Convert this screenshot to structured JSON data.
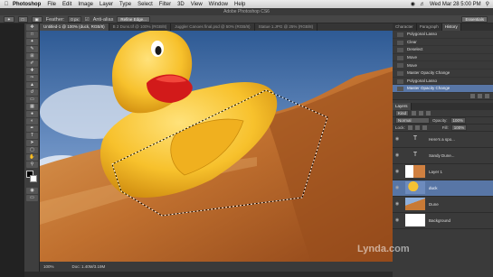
{
  "menubar": {
    "app": "Photoshop",
    "items": [
      "File",
      "Edit",
      "Image",
      "Layer",
      "Type",
      "Select",
      "Filter",
      "3D",
      "View",
      "Window",
      "Help"
    ],
    "clock": "Wed Mar 28  5:00 PM"
  },
  "window_title": "Adobe Photoshop CS6",
  "options": {
    "feather_label": "Feather:",
    "feather_value": "0 px",
    "antialias": "Anti-alias",
    "refine_edge": "Refine Edge...",
    "workspace": "Essentials"
  },
  "tabs": [
    {
      "label": "Untitled-1 @ 100% (duck, RGB/8)",
      "active": true
    },
    {
      "label": "B 2 Duns.tif @ 100% (RGB/8)",
      "active": false
    },
    {
      "label": "Juggler Canoes final.psd @ 50% (RGB/8)",
      "active": false
    },
    {
      "label": "Statue 1.JPG @ 25% (RGB/8)",
      "active": false
    }
  ],
  "status": {
    "zoom": "100%",
    "doc": "Doc: 1.40M/3.19M"
  },
  "panels": {
    "top_tabs": [
      "Character",
      "Paragraph",
      "History"
    ],
    "history": [
      {
        "label": "Polygonal Lasso",
        "selected": false
      },
      {
        "label": "Clear",
        "selected": false
      },
      {
        "label": "Deselect",
        "selected": false
      },
      {
        "label": "Move",
        "selected": false
      },
      {
        "label": "Move",
        "selected": false
      },
      {
        "label": "Master Opacity Change",
        "selected": false
      },
      {
        "label": "Polygonal Lasso",
        "selected": false
      },
      {
        "label": "Master Opacity Change",
        "selected": true
      }
    ],
    "layers_tab": "Layers",
    "kind": "Kind",
    "blend": "Normal",
    "opacity_label": "Opacity:",
    "opacity_value": "100%",
    "lock_label": "Lock:",
    "fill_label": "Fill:",
    "fill_value": "100%",
    "layers": [
      {
        "name": "Here's a spo...",
        "type": "text",
        "selected": false
      },
      {
        "name": "Sandy Dune...",
        "type": "text",
        "selected": false
      },
      {
        "name": "Layer 1",
        "type": "image",
        "selected": false
      },
      {
        "name": "duck",
        "type": "image",
        "selected": true
      },
      {
        "name": "Dune",
        "type": "image",
        "selected": false
      },
      {
        "name": "Background",
        "type": "image",
        "selected": false
      }
    ]
  },
  "watermark": "Lynda.com",
  "colors": {
    "accent": "#5876a6",
    "duck": "#f5c233",
    "sky": "#4f74a8",
    "dune": "#c06e2e"
  }
}
